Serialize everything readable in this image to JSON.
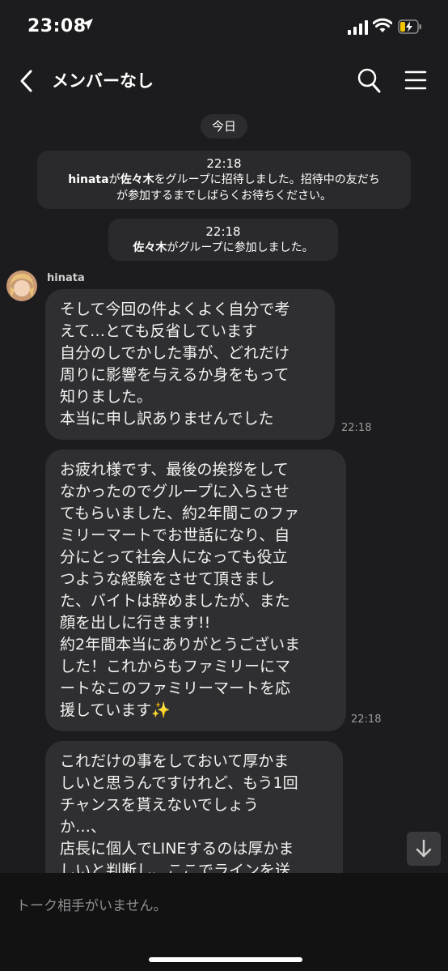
{
  "status_bar": {
    "time": "23:08",
    "location_arrow": "➤"
  },
  "header": {
    "title": "メンバーなし"
  },
  "date_label": "今日",
  "system_messages": [
    {
      "time": "22:18",
      "actor": "hinata",
      "text1": "が",
      "target": "佐々木",
      "text2": "をグループに招待しました。招待中の友だち",
      "line2": "が参加するまでしばらくお待ちください。"
    },
    {
      "time": "22:18",
      "actor": "佐々木",
      "text1": "がグループに参加しました。"
    }
  ],
  "sender_name": "hinata",
  "messages": [
    {
      "text": "そして今回の件よくよく自分で考\nえて…とても反省しています\n自分のしでかした事が、どれだけ\n周りに影響を与えるか身をもって\n知りました。\n本当に申し訳ありませんでした",
      "time": "22:18"
    },
    {
      "text": "お疲れ様です、最後の挨拶をして\nなかったのでグループに入らさせ\nてもらいました、約2年間このファ\nミリーマートでお世話になり、自\n分にとって社会人になっても役立\nつような経験をさせて頂きまし\nた、バイトは辞めましたが、また\n顔を出しに行きます!!\n約2年間本当にありがとうございま\nした！これからもファミリーにマ\nートなこのファミリーマートを応\n援しています✨",
      "time": "22:18"
    },
    {
      "text": "これだけの事をしておいて厚かま\nしいと思うんですけれど、もう1回\nチャンスを貰えないでしょう\nか…、\n店長に個人でLINEするのは厚かま\nしいと判断し、ここでラインを送"
    }
  ],
  "bottom": {
    "no_partner_text": "トーク相手がいません。"
  }
}
